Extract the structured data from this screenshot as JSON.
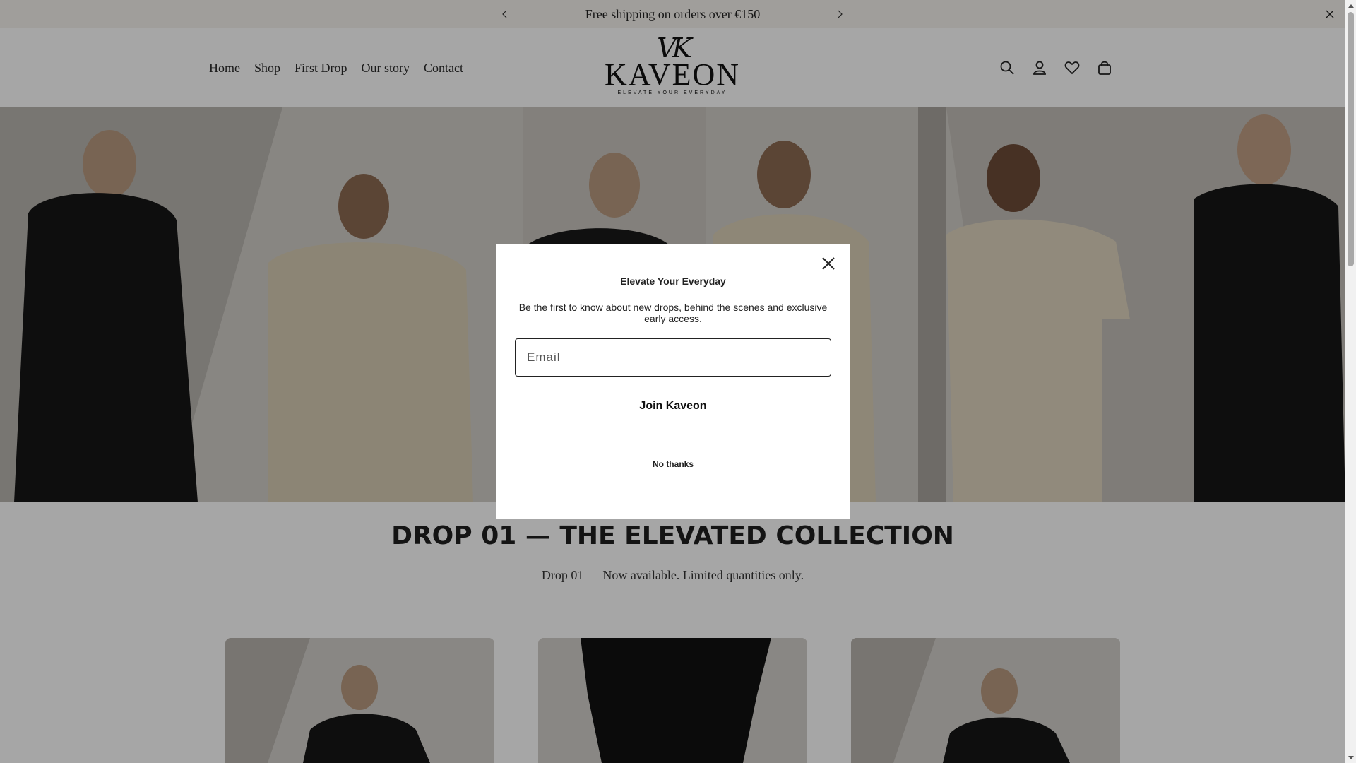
{
  "announcement": {
    "message": "Free shipping on orders over €150",
    "prev_icon": "chevron-left-icon",
    "next_icon": "chevron-right-icon",
    "close_icon": "close-icon"
  },
  "header": {
    "nav": [
      {
        "label": "Home"
      },
      {
        "label": "Shop"
      },
      {
        "label": "First Drop"
      },
      {
        "label": "Our story"
      },
      {
        "label": "Contact"
      }
    ],
    "logo": {
      "monogram": "VK",
      "wordmark": "KAVEON",
      "tagline": "ELEVATE YOUR EVERYDAY"
    },
    "icons": [
      "search-icon",
      "account-icon",
      "wishlist-heart-icon",
      "cart-bag-icon"
    ]
  },
  "collection": {
    "title": "DROP 01 — THE ELEVATED COLLECTION",
    "subtitle": "Drop 01 — Now available. Limited quantities only."
  },
  "modal": {
    "heading": "Elevate Your Everyday",
    "description": "Be the first to know about new drops, behind the scenes and exclusive early access.",
    "email_placeholder": "Email",
    "email_value": "",
    "submit_label": "Join Kaveon",
    "dismiss_label": "No thanks"
  },
  "colors": {
    "announcement_bg": "#f6f3ee",
    "overlay": "rgba(0,0,0,0.35)",
    "text": "#1a1a1a"
  }
}
